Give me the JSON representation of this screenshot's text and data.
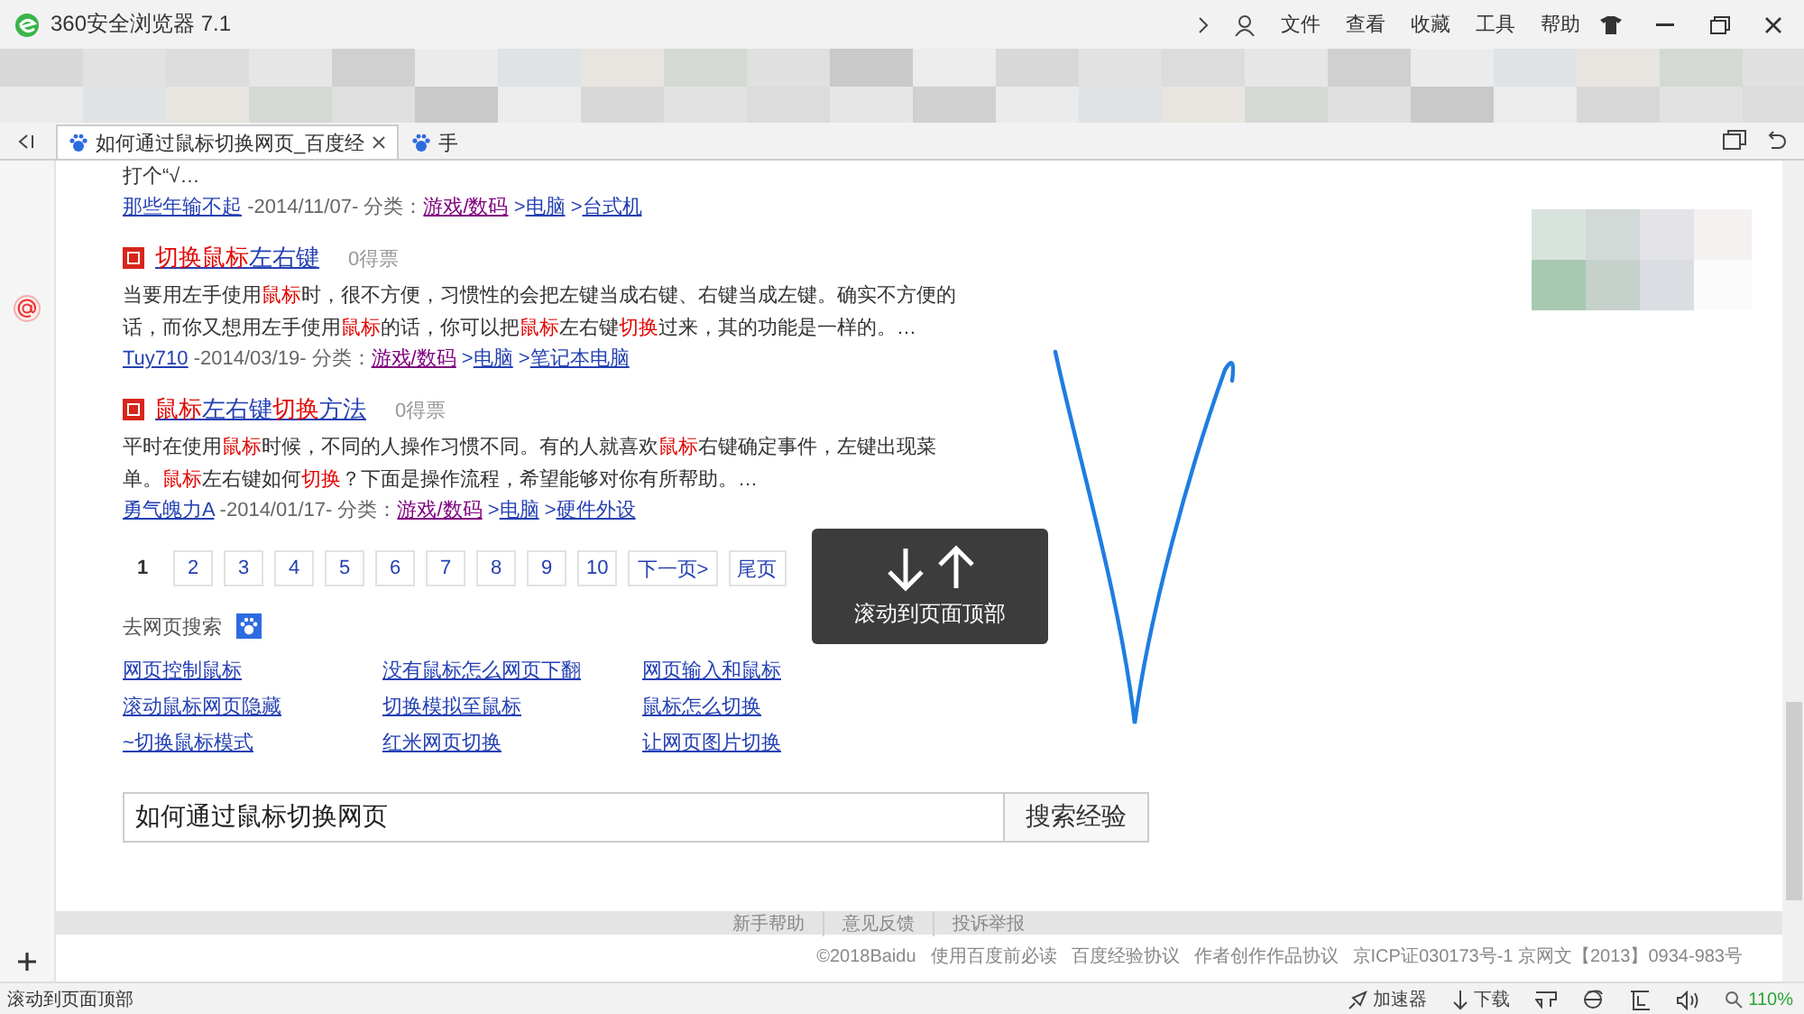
{
  "titlebar": {
    "title": "360安全浏览器 7.1",
    "menu": [
      "文件",
      "查看",
      "收藏",
      "工具",
      "帮助"
    ]
  },
  "tabs": [
    {
      "label": "如何通过鼠标切换网页_百度经",
      "selected": true
    },
    {
      "label": "手",
      "selected": false
    }
  ],
  "results": [
    {
      "snippet": [
        {
          "t": "打个“√…",
          "hl": false
        }
      ],
      "author": "那些年输不起",
      "date": "-2014/11/07- 分类：",
      "categories": [
        {
          "label": "游戏/数码",
          "visited": true
        },
        {
          "sep": ">",
          "label": "电脑",
          "visited": false
        },
        {
          "sep": ">",
          "label": "台式机",
          "visited": false
        }
      ]
    },
    {
      "title": [
        {
          "t": "切换鼠标",
          "hl": true
        },
        {
          "t": "左右键",
          "hl": false
        }
      ],
      "votes": "0得票",
      "snippet": [
        {
          "t": "当要用左手使用",
          "hl": false
        },
        {
          "t": "鼠标",
          "hl": true
        },
        {
          "t": "时，很不方便，习惯性的会把左键当成右键、右键当成左键。确实不方便的话，而你又想用左手使用",
          "hl": false
        },
        {
          "t": "鼠标",
          "hl": true
        },
        {
          "t": "的话，你可以把",
          "hl": false
        },
        {
          "t": "鼠标",
          "hl": true
        },
        {
          "t": "左右键",
          "hl": false
        },
        {
          "t": "切换",
          "hl": true
        },
        {
          "t": "过来，其的功能是一样的。…",
          "hl": false
        }
      ],
      "author": "Tuy710",
      "date": "-2014/03/19- 分类：",
      "categories": [
        {
          "label": "游戏/数码",
          "visited": true
        },
        {
          "sep": ">",
          "label": "电脑",
          "visited": false
        },
        {
          "sep": ">",
          "label": "笔记本电脑",
          "visited": false
        }
      ]
    },
    {
      "title": [
        {
          "t": "鼠标",
          "hl": true
        },
        {
          "t": "左右键",
          "hl": false
        },
        {
          "t": "切换",
          "hl": true
        },
        {
          "t": "方法",
          "hl": false
        }
      ],
      "votes": "0得票",
      "snippet": [
        {
          "t": "平时在使用",
          "hl": false
        },
        {
          "t": "鼠标",
          "hl": true
        },
        {
          "t": "时候，不同的人操作习惯不同。有的人就喜欢",
          "hl": false
        },
        {
          "t": "鼠标",
          "hl": true
        },
        {
          "t": "右键确定事件，左键出现菜单。",
          "hl": false
        },
        {
          "t": "鼠标",
          "hl": true
        },
        {
          "t": "左右键如何",
          "hl": false
        },
        {
          "t": "切换",
          "hl": true
        },
        {
          "t": "？下面是操作流程，希望能够对你有所帮助。…",
          "hl": false
        }
      ],
      "author": "勇气魄力A",
      "date": "-2014/01/17- 分类：",
      "categories": [
        {
          "label": "游戏/数码",
          "visited": true
        },
        {
          "sep": ">",
          "label": "电脑",
          "visited": false
        },
        {
          "sep": ">",
          "label": "硬件外设",
          "visited": false
        }
      ]
    }
  ],
  "pager": {
    "pages": [
      {
        "label": "1",
        "selected": true
      },
      {
        "label": "2",
        "selected": false
      },
      {
        "label": "3",
        "selected": false
      },
      {
        "label": "4",
        "selected": false
      },
      {
        "label": "5",
        "selected": false
      },
      {
        "label": "6",
        "selected": false
      },
      {
        "label": "7",
        "selected": false
      },
      {
        "label": "8",
        "selected": false
      },
      {
        "label": "9",
        "selected": false
      },
      {
        "label": "10",
        "selected": false
      }
    ],
    "next": "下一页>",
    "last": "尾页"
  },
  "related": {
    "label": "去网页搜索",
    "links": [
      "网页控制鼠标",
      "没有鼠标怎么网页下翻",
      "网页输入和鼠标",
      "滚动鼠标网页隐藏",
      "切换模拟至鼠标",
      "鼠标怎么切换",
      "~切换鼠标模式",
      "红米网页切换",
      "让网页图片切换"
    ]
  },
  "search": {
    "value": "如何通过鼠标切换网页",
    "button": "搜索经验"
  },
  "footer": {
    "links": [
      "新手帮助",
      "意见反馈",
      "投诉举报"
    ],
    "copyright": [
      "©2018Baidu",
      "使用百度前必读",
      "百度经验协议",
      "作者创作作品协议",
      "京ICP证030173号-1 京网文【2013】0934-983号"
    ]
  },
  "overlay": {
    "label": "滚动到页面顶部"
  },
  "status_bar": {
    "text": "滚动到页面顶部",
    "accelerator": "加速器",
    "download": "下载",
    "zoom": "110%"
  }
}
